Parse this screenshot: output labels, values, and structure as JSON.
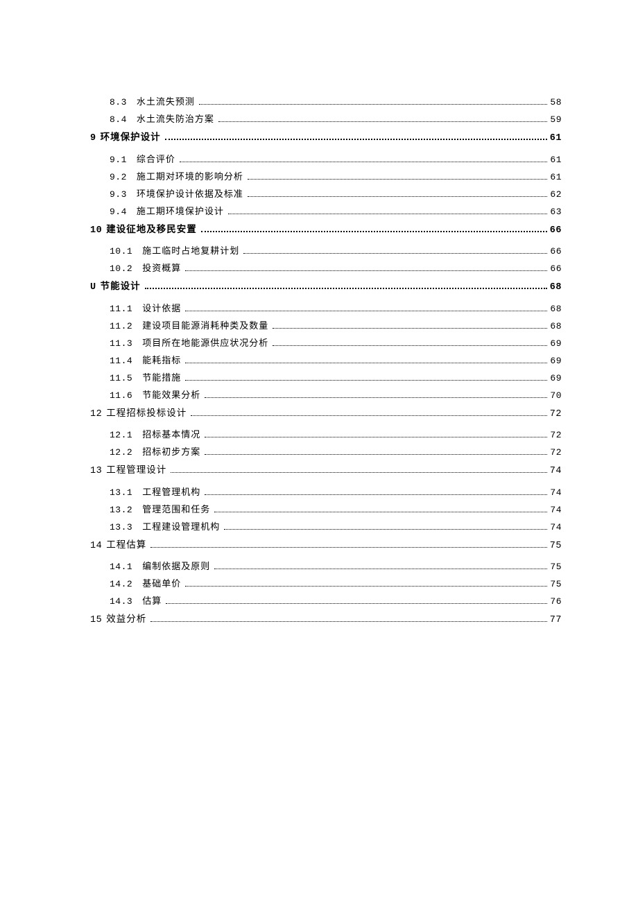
{
  "toc": [
    {
      "type": "sub",
      "num": "8.3",
      "title": "水土流失预测",
      "page": "58"
    },
    {
      "type": "sub",
      "num": "8.4",
      "title": "水土流失防治方案",
      "page": "59"
    },
    {
      "type": "chapter",
      "bold": true,
      "num": "9",
      "title": "环境保护设计",
      "page": "61"
    },
    {
      "type": "sub",
      "num": "9.1",
      "title": "综合评价",
      "page": "61"
    },
    {
      "type": "sub",
      "num": "9.2",
      "title": "施工期对环境的影响分析",
      "page": "61"
    },
    {
      "type": "sub",
      "num": "9.3",
      "title": "环境保护设计依据及标准",
      "page": "62"
    },
    {
      "type": "sub",
      "num": "9.4",
      "title": "施工期环境保护设计",
      "page": "63"
    },
    {
      "type": "chapter",
      "bold": true,
      "num": "10",
      "title": "建设征地及移民安置",
      "page": "66"
    },
    {
      "type": "sub",
      "num": "10.1",
      "title": "施工临时占地复耕计划",
      "page": "66"
    },
    {
      "type": "sub",
      "num": "10.2",
      "title": "投资概算",
      "page": "66"
    },
    {
      "type": "chapter",
      "bold": true,
      "num": "U",
      "title": "节能设计",
      "page": "68"
    },
    {
      "type": "sub",
      "num": "11.1",
      "title": "设计依据",
      "page": "68"
    },
    {
      "type": "sub",
      "num": "11.2",
      "title": "建设项目能源消耗种类及数量",
      "page": "68"
    },
    {
      "type": "sub",
      "num": "11.3",
      "title": "项目所在地能源供应状况分析",
      "page": "69"
    },
    {
      "type": "sub",
      "num": "11.4",
      "title": "能耗指标",
      "page": "69"
    },
    {
      "type": "sub",
      "num": "11.5",
      "title": "节能措施",
      "page": "69"
    },
    {
      "type": "sub",
      "num": "11.6",
      "title": "节能效果分析",
      "page": "70"
    },
    {
      "type": "chapter",
      "bold": false,
      "num": "12",
      "title": "工程招标投标设计",
      "page": "72"
    },
    {
      "type": "sub",
      "num": "12.1",
      "title": "招标基本情况",
      "page": "72"
    },
    {
      "type": "sub",
      "num": "12.2",
      "title": "招标初步方案",
      "page": "72"
    },
    {
      "type": "chapter",
      "bold": false,
      "num": "13",
      "title": "工程管理设计",
      "page": "74"
    },
    {
      "type": "sub",
      "num": "13.1",
      "title": "工程管理机构",
      "page": "74"
    },
    {
      "type": "sub",
      "num": "13.2",
      "title": "管理范围和任务",
      "page": "74"
    },
    {
      "type": "sub",
      "num": "13.3",
      "title": "工程建设管理机构",
      "page": "74"
    },
    {
      "type": "chapter",
      "bold": false,
      "num": "14",
      "title": "工程估算",
      "page": "75"
    },
    {
      "type": "sub",
      "num": "14.1",
      "title": "编制依据及原则",
      "page": "75"
    },
    {
      "type": "sub",
      "num": "14.2",
      "title": "基础单价",
      "page": "75"
    },
    {
      "type": "sub",
      "num": "14.3",
      "title": "估算",
      "page": "76"
    },
    {
      "type": "chapter",
      "bold": false,
      "num": "15",
      "title": "效益分析",
      "page": "77"
    }
  ]
}
